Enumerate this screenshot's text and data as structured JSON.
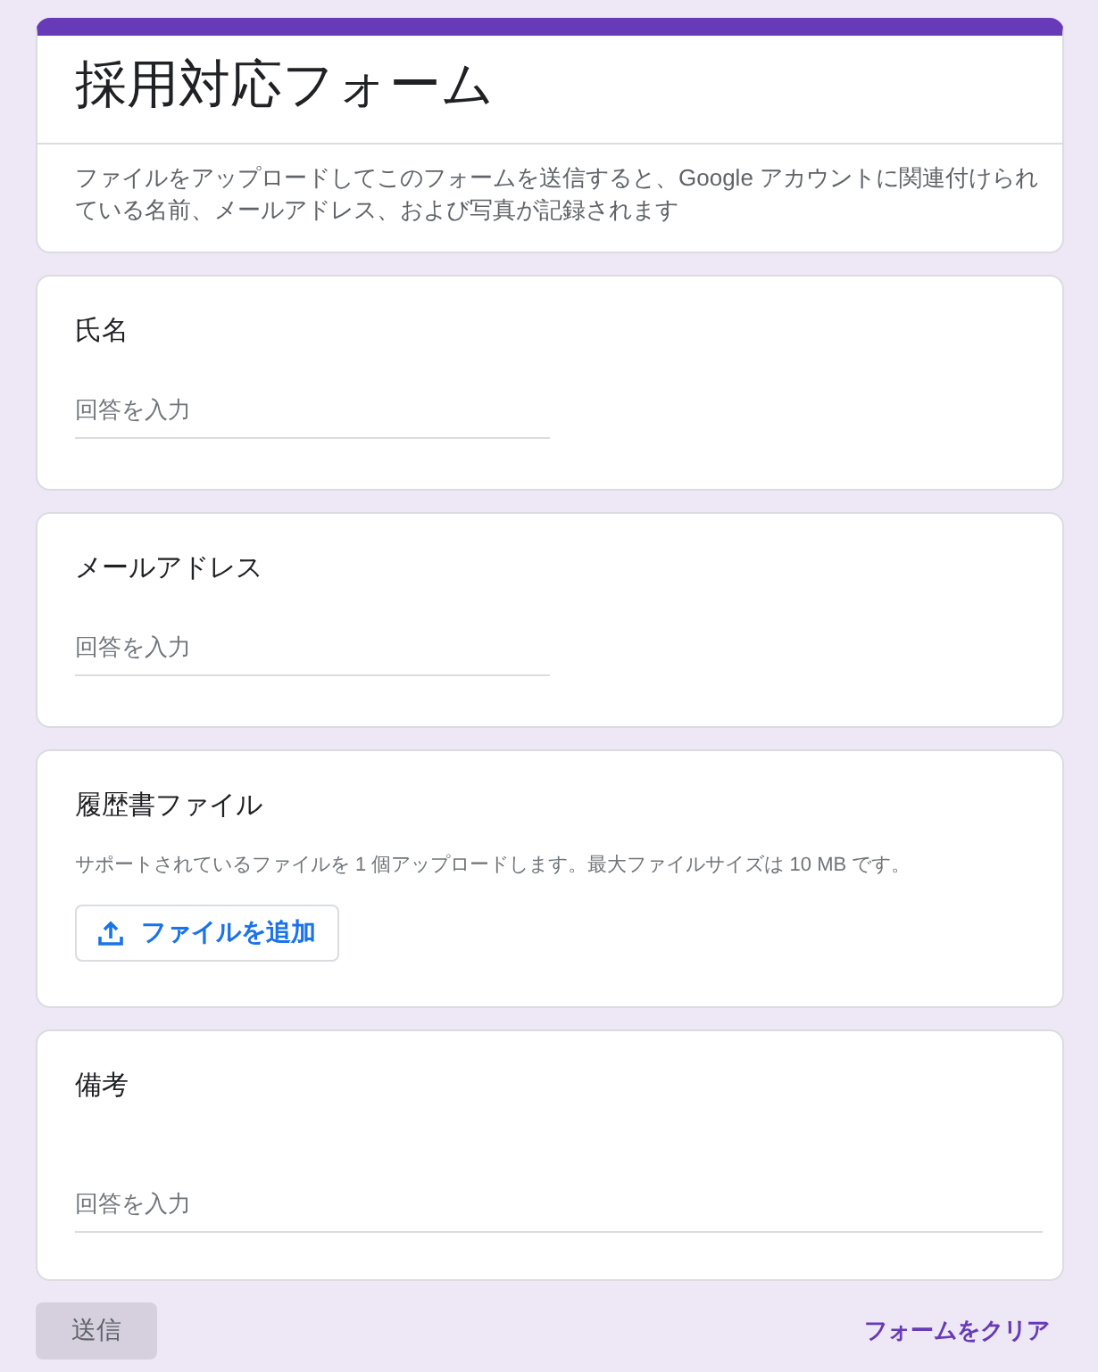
{
  "form": {
    "title": "採用対応フォーム",
    "description": "ファイルをアップロードしてこのフォームを送信すると、Google アカウントに関連付けられている名前、メールアドレス、および写真が記録されます"
  },
  "questions": [
    {
      "kind": "short",
      "label": "氏名",
      "placeholder": "回答を入力"
    },
    {
      "kind": "short",
      "label": "メールアドレス",
      "placeholder": "回答を入力"
    },
    {
      "kind": "file",
      "label": "履歴書ファイル",
      "hint": "サポートされているファイルを 1 個アップロードします。最大ファイルサイズは 10 MB です。",
      "button": "ファイルを追加"
    },
    {
      "kind": "paragraph",
      "label": "備考",
      "placeholder": "回答を入力"
    }
  ],
  "footer": {
    "submit": {
      "label": "送信",
      "disabled": true
    },
    "clear_link": "フォームをクリア"
  }
}
